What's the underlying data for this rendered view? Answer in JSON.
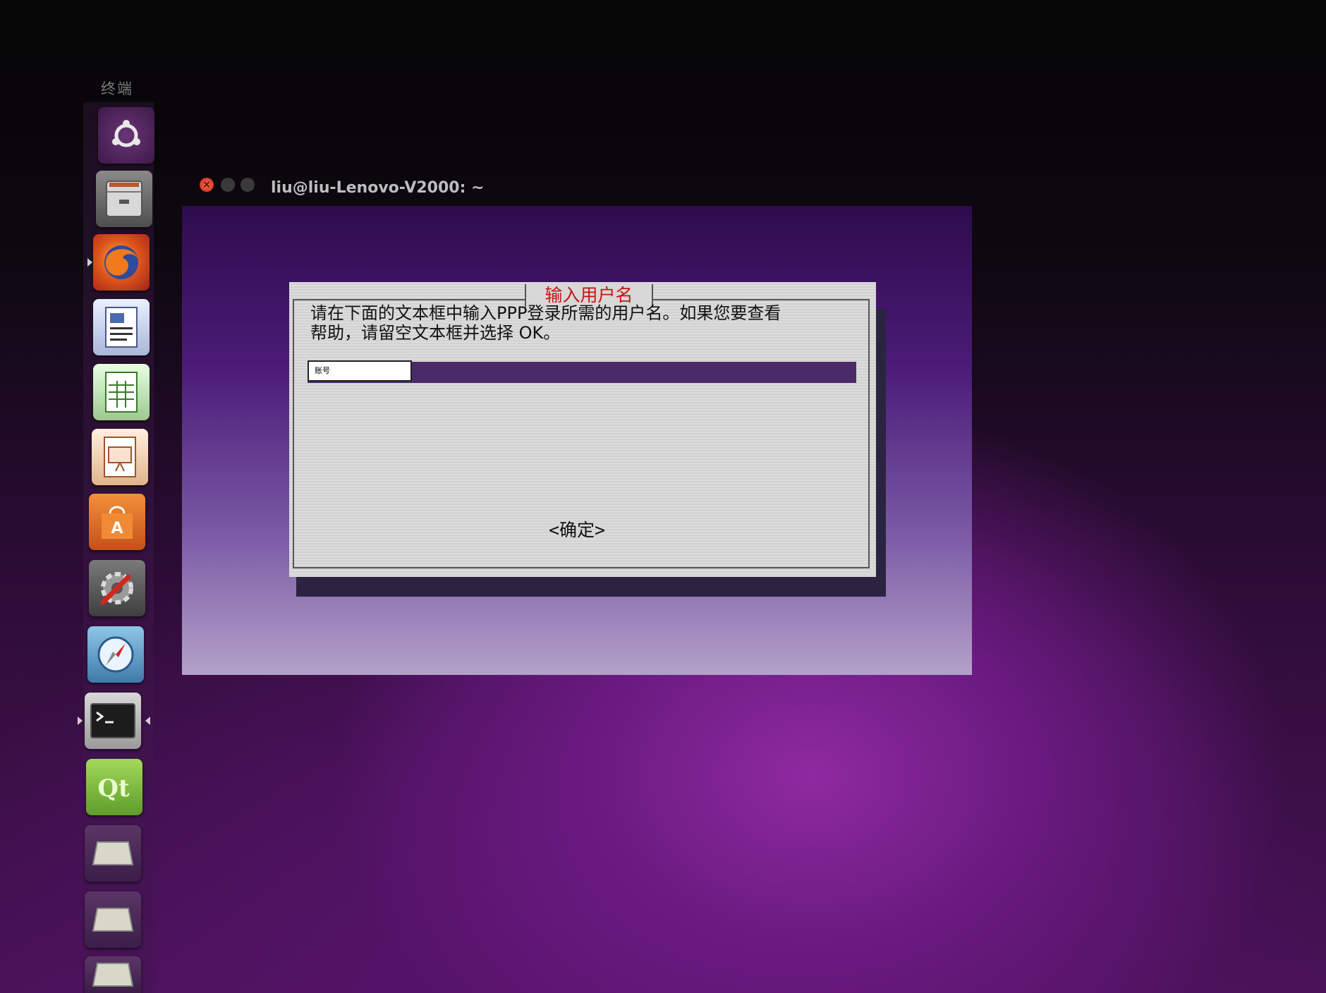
{
  "top_bar": {
    "title": "终端"
  },
  "launcher": {
    "items": [
      {
        "name": "dash-home",
        "icon": "ubuntu-logo-icon"
      },
      {
        "name": "files",
        "icon": "file-cabinet-icon"
      },
      {
        "name": "firefox",
        "icon": "firefox-icon"
      },
      {
        "name": "libreoffice-writer",
        "icon": "writer-document-icon"
      },
      {
        "name": "libreoffice-calc",
        "icon": "spreadsheet-icon"
      },
      {
        "name": "libreoffice-impress",
        "icon": "presentation-icon"
      },
      {
        "name": "software-center",
        "icon": "shopping-bag-icon"
      },
      {
        "name": "system-settings",
        "icon": "wrench-gear-icon"
      },
      {
        "name": "browser",
        "icon": "compass-icon"
      },
      {
        "name": "terminal",
        "icon": "terminal-icon"
      },
      {
        "name": "qt-creator",
        "icon": "qt-logo-icon"
      },
      {
        "name": "drive-1",
        "icon": "drive-icon"
      },
      {
        "name": "drive-2",
        "icon": "drive-icon"
      },
      {
        "name": "drive-3",
        "icon": "drive-icon"
      }
    ]
  },
  "terminal_window": {
    "title": "liu@liu-Lenovo-V2000: ~"
  },
  "dialog": {
    "title": "输入用户名",
    "prompt_line1": "请在下面的文本框中输入PPP登录所需的用户名。如果您要查看",
    "prompt_line2": "帮助，请留空文本框并选择 OK。",
    "input_value": "账号",
    "ok_label": "<确定>"
  },
  "colors": {
    "dialog_title": "#c81414",
    "input_bar": "#4b2a6a",
    "dialog_bg": "#d6d6d6"
  }
}
